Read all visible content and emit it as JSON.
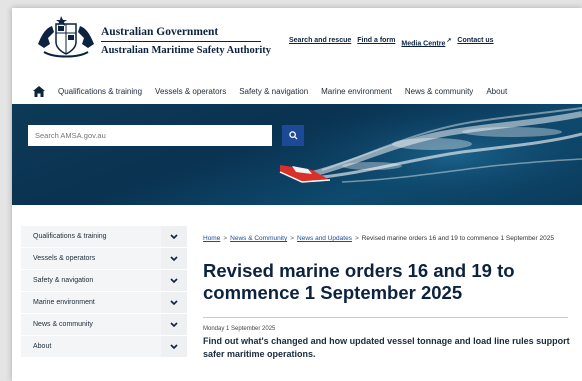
{
  "header": {
    "gov_title": "Australian Government",
    "gov_subtitle": "Australian Maritime Safety Authority",
    "links": [
      {
        "label": "Search and rescue"
      },
      {
        "label": "Find a form"
      },
      {
        "label": "Media Centre"
      },
      {
        "label": "Contact us"
      }
    ]
  },
  "nav": {
    "items": [
      {
        "label": "Qualifications & training"
      },
      {
        "label": "Vessels & operators"
      },
      {
        "label": "Safety & navigation"
      },
      {
        "label": "Marine environment"
      },
      {
        "label": "News & community"
      },
      {
        "label": "About"
      }
    ]
  },
  "search": {
    "placeholder": "Search AMSA.gov.au"
  },
  "sidebar": {
    "items": [
      {
        "label": "Qualifications & training"
      },
      {
        "label": "Vessels & operators"
      },
      {
        "label": "Safety & navigation"
      },
      {
        "label": "Marine environment"
      },
      {
        "label": "News & community"
      },
      {
        "label": "About"
      }
    ]
  },
  "breadcrumb": {
    "home": "Home",
    "news": "News & Community",
    "updates": "News and Updates",
    "current": "Revised marine orders 16 and 19 to commence 1 September 2025"
  },
  "article": {
    "title": "Revised marine orders 16 and 19 to commence 1 September 2025",
    "date": "Monday 1 September 2025",
    "lead": "Find out what's changed and how updated vessel tonnage and load line rules support safer maritime operations."
  },
  "colors": {
    "navy": "#0c2340",
    "accent": "#1c4a96",
    "boat": "#d9302a"
  }
}
